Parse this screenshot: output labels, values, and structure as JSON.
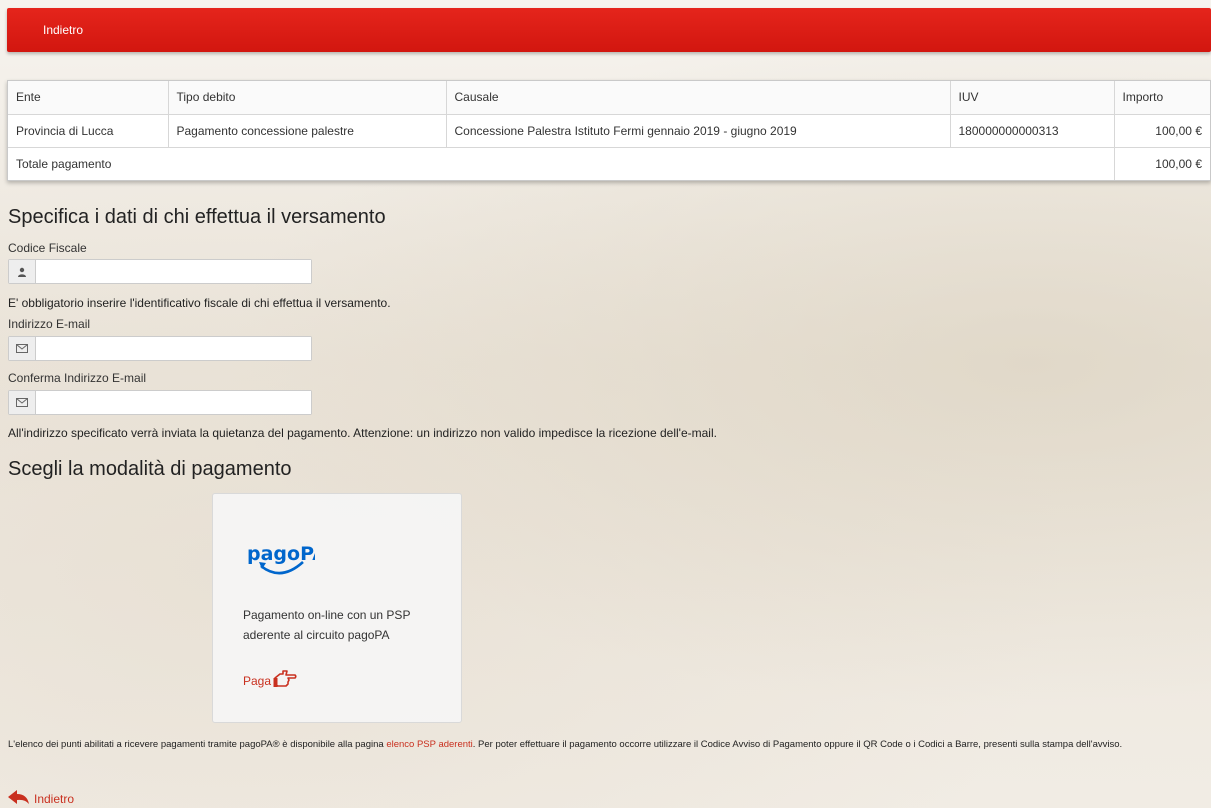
{
  "topbar": {
    "back_label": "Indietro"
  },
  "table": {
    "headers": [
      "Ente",
      "Tipo debito",
      "Causale",
      "IUV",
      "Importo"
    ],
    "row": {
      "ente": "Provincia di Lucca",
      "tipo": "Pagamento concessione palestre",
      "causale": "Concessione Palestra Istituto Fermi gennaio 2019 - giugno 2019",
      "iuv": "180000000000313",
      "importo": "100,00 €"
    },
    "total_label": "Totale pagamento",
    "total_value": "100,00 €"
  },
  "payer": {
    "heading": "Specifica i dati di chi effettua il versamento",
    "cf_label": "Codice Fiscale",
    "cf_value": "",
    "cf_help": "E' obbligatorio inserire l'identificativo fiscale di chi effettua il versamento.",
    "email_label": "Indirizzo E-mail",
    "email_value": "",
    "email_confirm_label": "Conferma Indirizzo E-mail",
    "email_confirm_value": "",
    "email_help": "All'indirizzo specificato verrà inviata la quietanza del pagamento. Attenzione: un indirizzo non valido impedisce la ricezione dell'e-mail."
  },
  "payment": {
    "heading": "Scegli la modalità di pagamento",
    "logo_text": "pagoPA",
    "description": "Pagamento on-line con un PSP aderente al circuito pagoPA",
    "pay_label": "Paga"
  },
  "footer": {
    "note_before": "L'elenco dei punti abilitati a ricevere pagamenti tramite pagoPA® è disponibile alla pagina ",
    "note_link": "elenco PSP aderenti",
    "note_after": ". Per poter effettuare il pagamento occorre utilizzare il Codice Avviso di Pagamento oppure il QR Code o i Codici a Barre, presenti sulla stampa dell'avviso.",
    "back_label": "Indietro"
  },
  "colors": {
    "topbar": "#d2160f",
    "link": "#c9301f",
    "pagopa_blue": "#0066cc"
  }
}
